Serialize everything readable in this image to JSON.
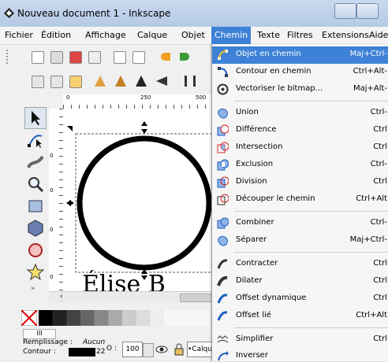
{
  "window": {
    "title": "Nouveau document 1 - Inkscape"
  },
  "menubar": {
    "items": [
      "Fichier",
      "Édition",
      "Affichage",
      "Calque",
      "Objet",
      "Chemin",
      "Texte",
      "Filtres",
      "Extensions",
      "Aide"
    ],
    "active": "Chemin"
  },
  "ruler": {
    "labels": [
      "0",
      "250",
      "500"
    ]
  },
  "vruler": {
    "labels": [
      "0",
      "0",
      "0",
      "0"
    ]
  },
  "canvas": {
    "text": "Élise B"
  },
  "status": {
    "fill_label": "Remplissage :",
    "fill_value": "Aucun",
    "stroke_label": "Contour :",
    "stroke_width": "22",
    "opacity_label": "O :",
    "opacity_value": "100",
    "layer_label": "•Calqu",
    "scroll_label": "III",
    "more_label": "»"
  },
  "menu": {
    "items": [
      {
        "label": "Objet en chemin",
        "shortcut": "Maj+Ctrl-",
        "icon": "object-to-path-icon",
        "highlight": true
      },
      {
        "label": "Contour en chemin",
        "shortcut": "Ctrl+Alt-",
        "icon": "stroke-to-path-icon"
      },
      {
        "label": "Vectoriser le bitmap...",
        "shortcut": "Maj+Alt-",
        "icon": "trace-bitmap-icon"
      },
      {
        "label": "Union",
        "shortcut": "Ctrl-",
        "icon": "union-icon"
      },
      {
        "label": "Différence",
        "shortcut": "Ctrl",
        "icon": "difference-icon"
      },
      {
        "label": "Intersection",
        "shortcut": "Ctrl",
        "icon": "intersection-icon"
      },
      {
        "label": "Exclusion",
        "shortcut": "Ctrl-",
        "icon": "exclusion-icon"
      },
      {
        "label": "Division",
        "shortcut": "Ctrl",
        "icon": "division-icon"
      },
      {
        "label": "Découper le chemin",
        "shortcut": "Ctrl+Alt",
        "icon": "cut-path-icon"
      },
      {
        "label": "Combiner",
        "shortcut": "Ctrl-",
        "icon": "combine-icon"
      },
      {
        "label": "Séparer",
        "shortcut": "Maj+Ctrl-",
        "icon": "break-apart-icon"
      },
      {
        "label": "Contracter",
        "shortcut": "Ctrl",
        "icon": "inset-icon"
      },
      {
        "label": "Dilater",
        "shortcut": "Ctrl",
        "icon": "outset-icon"
      },
      {
        "label": "Offset dynamique",
        "shortcut": "Ctrl",
        "icon": "dynamic-offset-icon"
      },
      {
        "label": "Offset lié",
        "shortcut": "Ctrl+Alt",
        "icon": "linked-offset-icon"
      },
      {
        "label": "Simplifier",
        "shortcut": "Ctrl",
        "icon": "simplify-icon"
      },
      {
        "label": "Inverser",
        "shortcut": "",
        "icon": "reverse-icon"
      }
    ]
  },
  "colors": {
    "menu_highlight": "#3d82d6",
    "titlebar": "#c9d9ee",
    "icon_blue": "#1f5fbf",
    "icon_red": "#d02020"
  }
}
